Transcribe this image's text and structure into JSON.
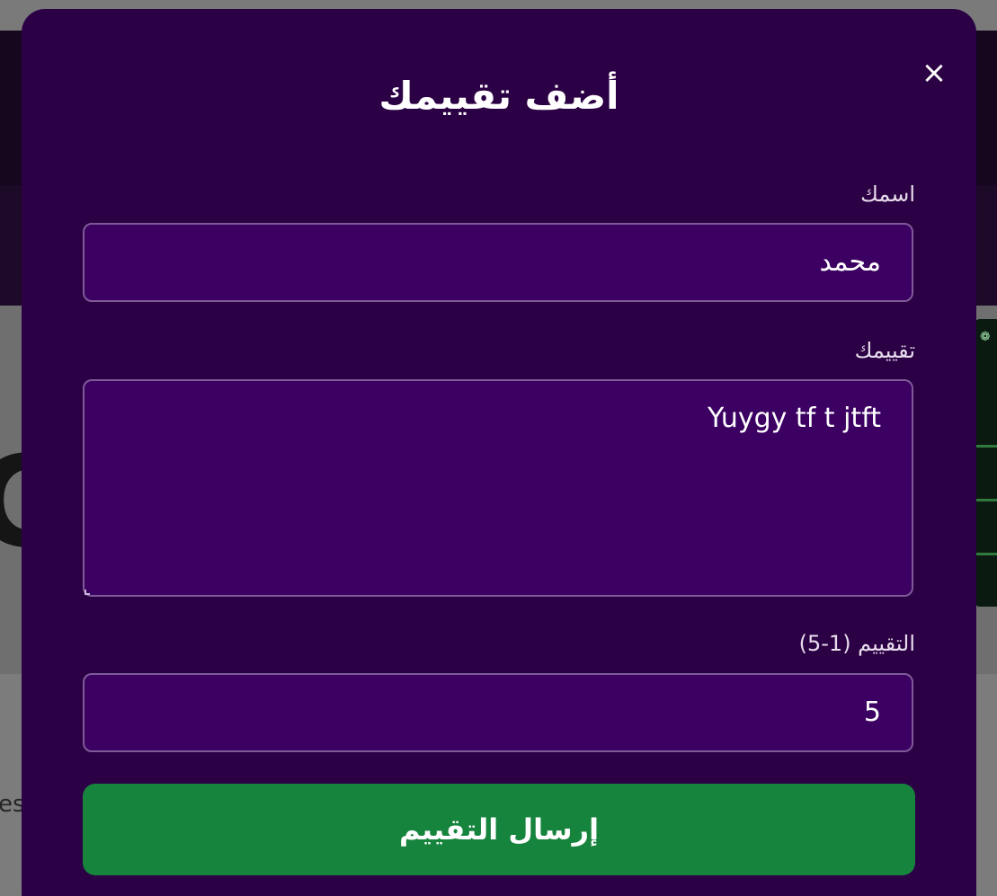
{
  "background": {
    "partial_text": "es",
    "partial_letter": "C"
  },
  "modal": {
    "title": "أضف تقييمك",
    "close_symbol": "×",
    "name_field": {
      "label": "اسمك",
      "value": "محمد"
    },
    "review_field": {
      "label": "تقييمك",
      "value": "Yuygy tf t jtft"
    },
    "rating_field": {
      "label": "التقييم (1-5)",
      "value": "5"
    },
    "submit_label": "إرسال التقييم"
  },
  "colors": {
    "modal_bg": "#2c0044",
    "field_bg": "#3b0062",
    "submit_bg": "#17843e"
  }
}
